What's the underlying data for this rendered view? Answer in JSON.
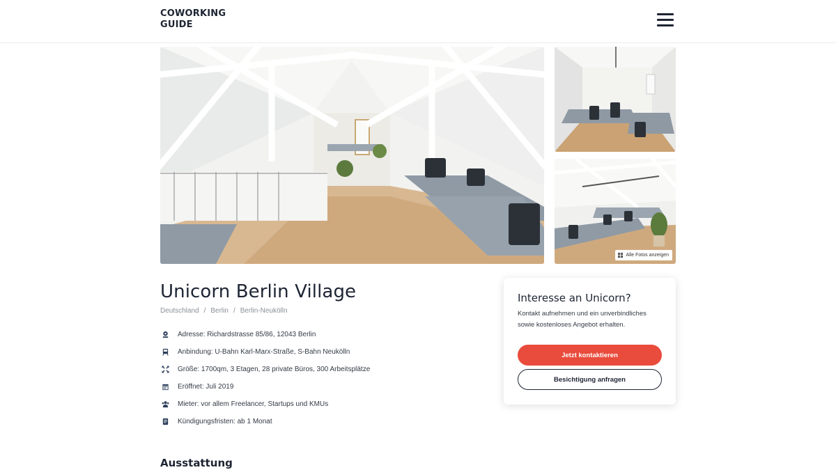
{
  "header": {
    "logo_line1": "COWORKING",
    "logo_line2": "GUIDE",
    "menu_icon": "hamburger-menu-icon"
  },
  "gallery": {
    "all_photos_label": "Alle Fotos anzeigen",
    "all_photos_icon": "grid-icon"
  },
  "space": {
    "title": "Unicorn Berlin Village",
    "breadcrumb": [
      "Deutschland",
      "Berlin",
      "Berlin-Neukölln"
    ],
    "facts": [
      {
        "icon": "location-pin-icon",
        "text": "Adresse: Richardstrasse 85/86, 12043 Berlin"
      },
      {
        "icon": "train-icon",
        "text": "Anbindung: U-Bahn Karl-Marx-Straße, S-Bahn Neukölln"
      },
      {
        "icon": "expand-arrows-icon",
        "text": "Größe: 1700qm, 3 Etagen, 28 private Büros, 300 Arbeitsplätze"
      },
      {
        "icon": "calendar-icon",
        "text": "Eröffnet: Juli 2019"
      },
      {
        "icon": "users-icon",
        "text": "Mieter: vor allem Freelancer, Startups und KMUs"
      },
      {
        "icon": "document-icon",
        "text": "Kündigungsfristen: ab 1 Monat"
      }
    ],
    "amenities_heading": "Ausstattung"
  },
  "contact_card": {
    "heading": "Interesse an Unicorn?",
    "text": "Kontakt aufnehmen und ein unverbindliches sowie kostenloses Angebot erhalten.",
    "primary_button": "Jetzt kontaktieren",
    "secondary_button": "Besichtigung anfragen"
  },
  "colors": {
    "accent": "#e94b3c",
    "text_dark": "#1d2433",
    "muted": "#8a8f98"
  }
}
